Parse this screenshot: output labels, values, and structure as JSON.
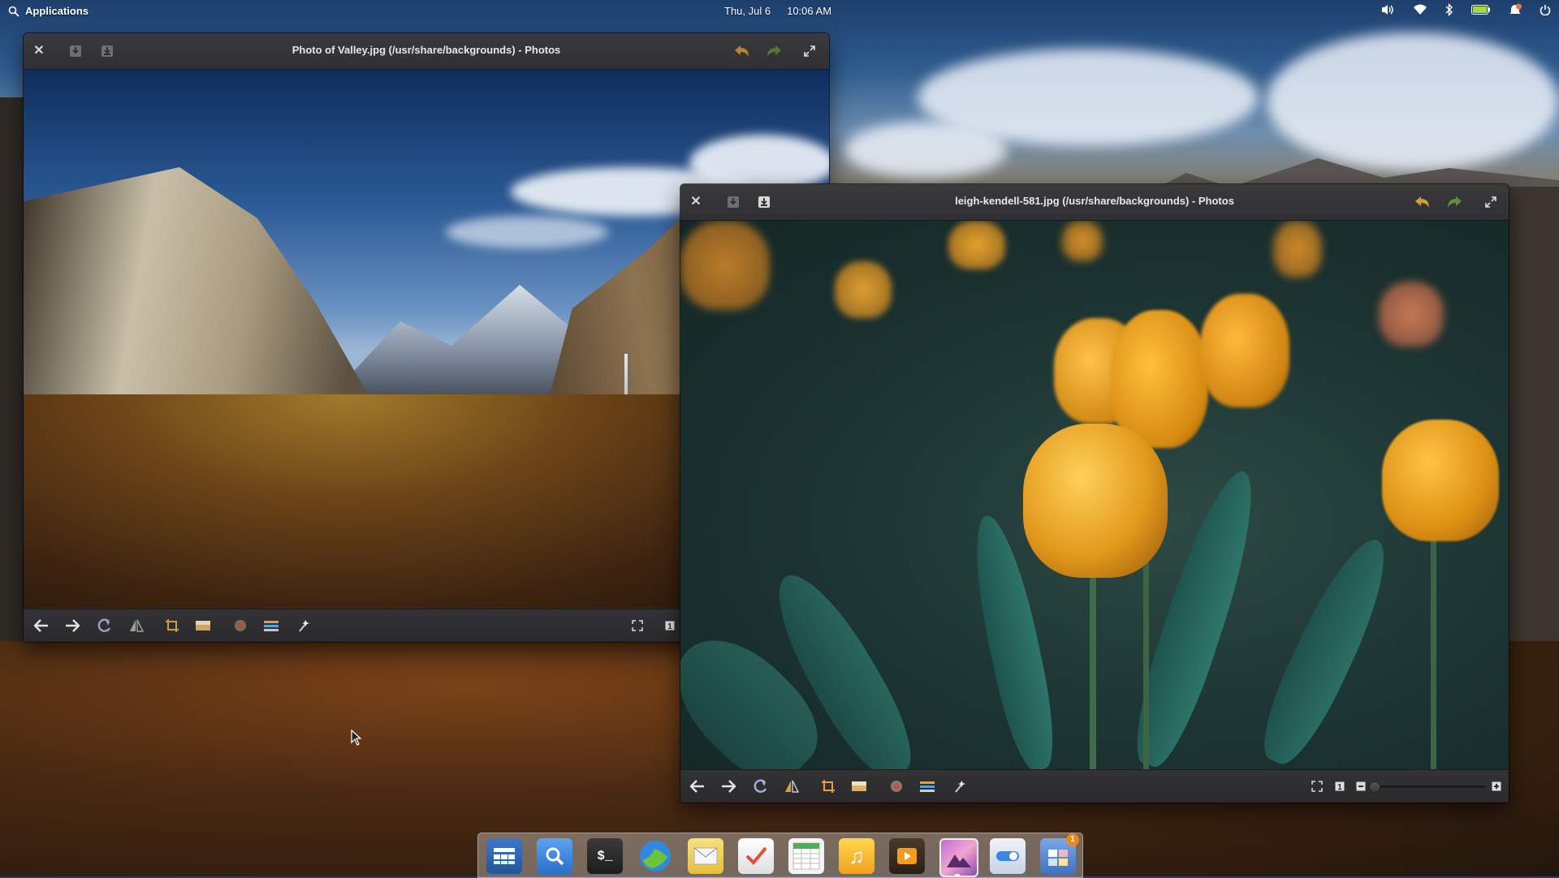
{
  "panel": {
    "applications_label": "Applications",
    "date": "Thu, Jul 6",
    "time": "10:06 AM",
    "indicators": [
      "volume-icon",
      "wifi-icon",
      "bluetooth-icon",
      "battery-icon",
      "notifications-icon",
      "power-icon"
    ]
  },
  "windows": [
    {
      "id": "valley",
      "title": "Photo of Valley.jpg (/usr/share/backgrounds) - Photos",
      "focused": false
    },
    {
      "id": "tulips",
      "title": "leigh-kendell-581.jpg (/usr/share/backgrounds) - Photos",
      "focused": true,
      "zoom_fraction": 0.0
    }
  ],
  "toolbar_actions": [
    "back-button",
    "forward-button",
    "rotate-button",
    "flip-button",
    "crop-button",
    "straighten-button",
    "red-eye-button",
    "adjust-button",
    "enhance-button"
  ],
  "dock": {
    "items": [
      "multitasking-view",
      "files",
      "terminal",
      "web-browser",
      "mail",
      "tasks",
      "spreadsheet",
      "music",
      "videos",
      "photos",
      "system-settings",
      "app-center"
    ],
    "app_center_badge": "1"
  },
  "colors": {
    "accent_orange": "#f0a020",
    "accent_green": "#68b723"
  }
}
